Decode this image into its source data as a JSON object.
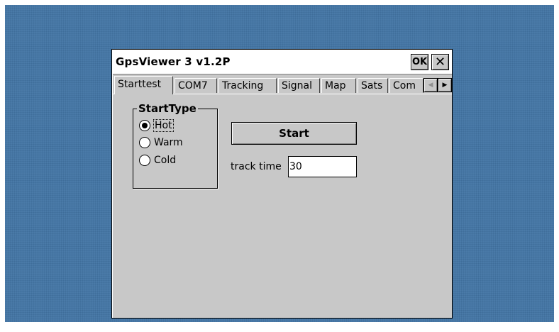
{
  "window": {
    "title": "GpsViewer 3 v1.2P",
    "ok_label": "OK",
    "close_label": "✕"
  },
  "tabs": [
    {
      "label": "Starttest",
      "active": true
    },
    {
      "label": "COM7"
    },
    {
      "label": "Tracking"
    },
    {
      "label": "Signal"
    },
    {
      "label": "Map"
    },
    {
      "label": "Sats"
    },
    {
      "label": "Com"
    }
  ],
  "tab_scroll": {
    "left_icon": "◀",
    "right_icon": "▶"
  },
  "start_type": {
    "legend": "StartType",
    "options": [
      {
        "label": "Hot",
        "selected": true
      },
      {
        "label": "Warm",
        "selected": false
      },
      {
        "label": "Cold",
        "selected": false
      }
    ]
  },
  "start_button": "Start",
  "track_time": {
    "label": "track time",
    "value": "30"
  },
  "colors": {
    "desktop": "#4a7aa8",
    "window_face": "#c8c8c8"
  }
}
